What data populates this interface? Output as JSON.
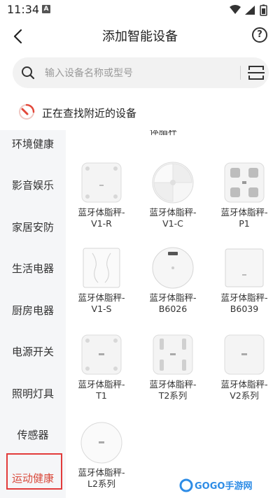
{
  "status_bar": {
    "time": "11:34",
    "notification_badge": "A",
    "icons": [
      "wifi-icon",
      "signal-icon",
      "battery-icon"
    ]
  },
  "header": {
    "title": "添加智能设备",
    "back_icon": "back-arrow-icon",
    "help_label": "?"
  },
  "search": {
    "placeholder": "输入设备名称或型号",
    "value": "",
    "scan_icon": "scan-icon"
  },
  "finding": {
    "text": "正在查找附近的设备"
  },
  "sidebar": {
    "items": [
      {
        "label": "环境健康"
      },
      {
        "label": "影音娱乐"
      },
      {
        "label": "家居安防"
      },
      {
        "label": "生活电器"
      },
      {
        "label": "厨房电器"
      },
      {
        "label": "电源开关"
      },
      {
        "label": "照明灯具"
      },
      {
        "label": "传感器"
      },
      {
        "label": "运动健康"
      }
    ],
    "active_index": 8
  },
  "content": {
    "cut_heading": "体脂秤",
    "devices": [
      {
        "name_line1": "蓝牙体脂秤-",
        "name_line2": "V1-R"
      },
      {
        "name_line1": "蓝牙体脂秤-",
        "name_line2": "V1-C"
      },
      {
        "name_line1": "蓝牙体脂秤-",
        "name_line2": "P1"
      },
      {
        "name_line1": "蓝牙体脂秤-",
        "name_line2": "V1-S"
      },
      {
        "name_line1": "蓝牙体脂秤-",
        "name_line2": "B6026"
      },
      {
        "name_line1": "蓝牙体脂秤-",
        "name_line2": "B6039"
      },
      {
        "name_line1": "蓝牙体脂秤-",
        "name_line2": "T1"
      },
      {
        "name_line1": "蓝牙体脂秤-",
        "name_line2": "T2系列"
      },
      {
        "name_line1": "蓝牙体脂秤-",
        "name_line2": "V2系列"
      },
      {
        "name_line1": "蓝牙体脂秤-",
        "name_line2": "L2系列"
      }
    ]
  },
  "watermark": {
    "text": "GOGO手游网"
  },
  "colors": {
    "accent": "#d94a3c",
    "highlight_box": "#e23b3b",
    "sidebar_bg": "#f5f6f8"
  }
}
